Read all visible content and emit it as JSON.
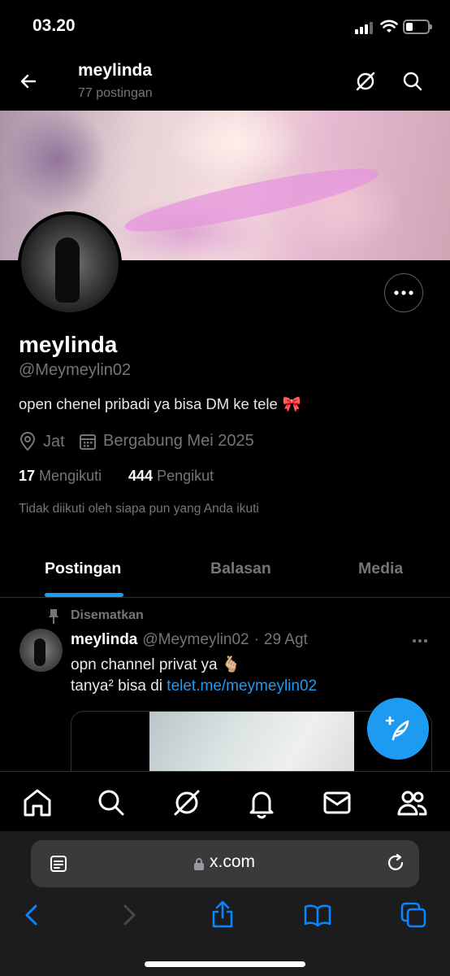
{
  "status_bar": {
    "time": "03.20"
  },
  "header": {
    "name": "meylinda",
    "posts": "77 postingan"
  },
  "profile": {
    "name": "meylinda",
    "handle": "@Meymeylin02",
    "bio": "open chenel pribadi ya bisa DM ke tele",
    "bio_emoji": "🎀",
    "location": "Jat",
    "joined": "Bergabung Mei 2025",
    "following_count": "17",
    "following_label": "Mengikuti",
    "followers_count": "444",
    "followers_label": "Pengikut",
    "not_followed_note": "Tidak diikuti oleh siapa pun yang Anda ikuti"
  },
  "tabs": [
    {
      "label": "Postingan",
      "active": true
    },
    {
      "label": "Balasan",
      "active": false
    },
    {
      "label": "Media",
      "active": false
    }
  ],
  "tweet": {
    "pinned_label": "Disematkan",
    "name": "meylinda",
    "handle": "@Meymeylin02",
    "separator": "·",
    "date": "29 Agt",
    "line1": "opn channel privat ya",
    "line1_emoji": "🫰🏼",
    "line2_prefix": "tanya² bisa di",
    "link": "telet.me/meymeylin02"
  },
  "bottom_nav": [
    "home-icon",
    "search-icon",
    "grok-icon",
    "notifications-icon",
    "messages-icon",
    "communities-icon"
  ],
  "browser": {
    "url": "x.com"
  },
  "colors": {
    "accent": "#1d9bf0",
    "background": "#000000",
    "muted": "#71767b"
  }
}
